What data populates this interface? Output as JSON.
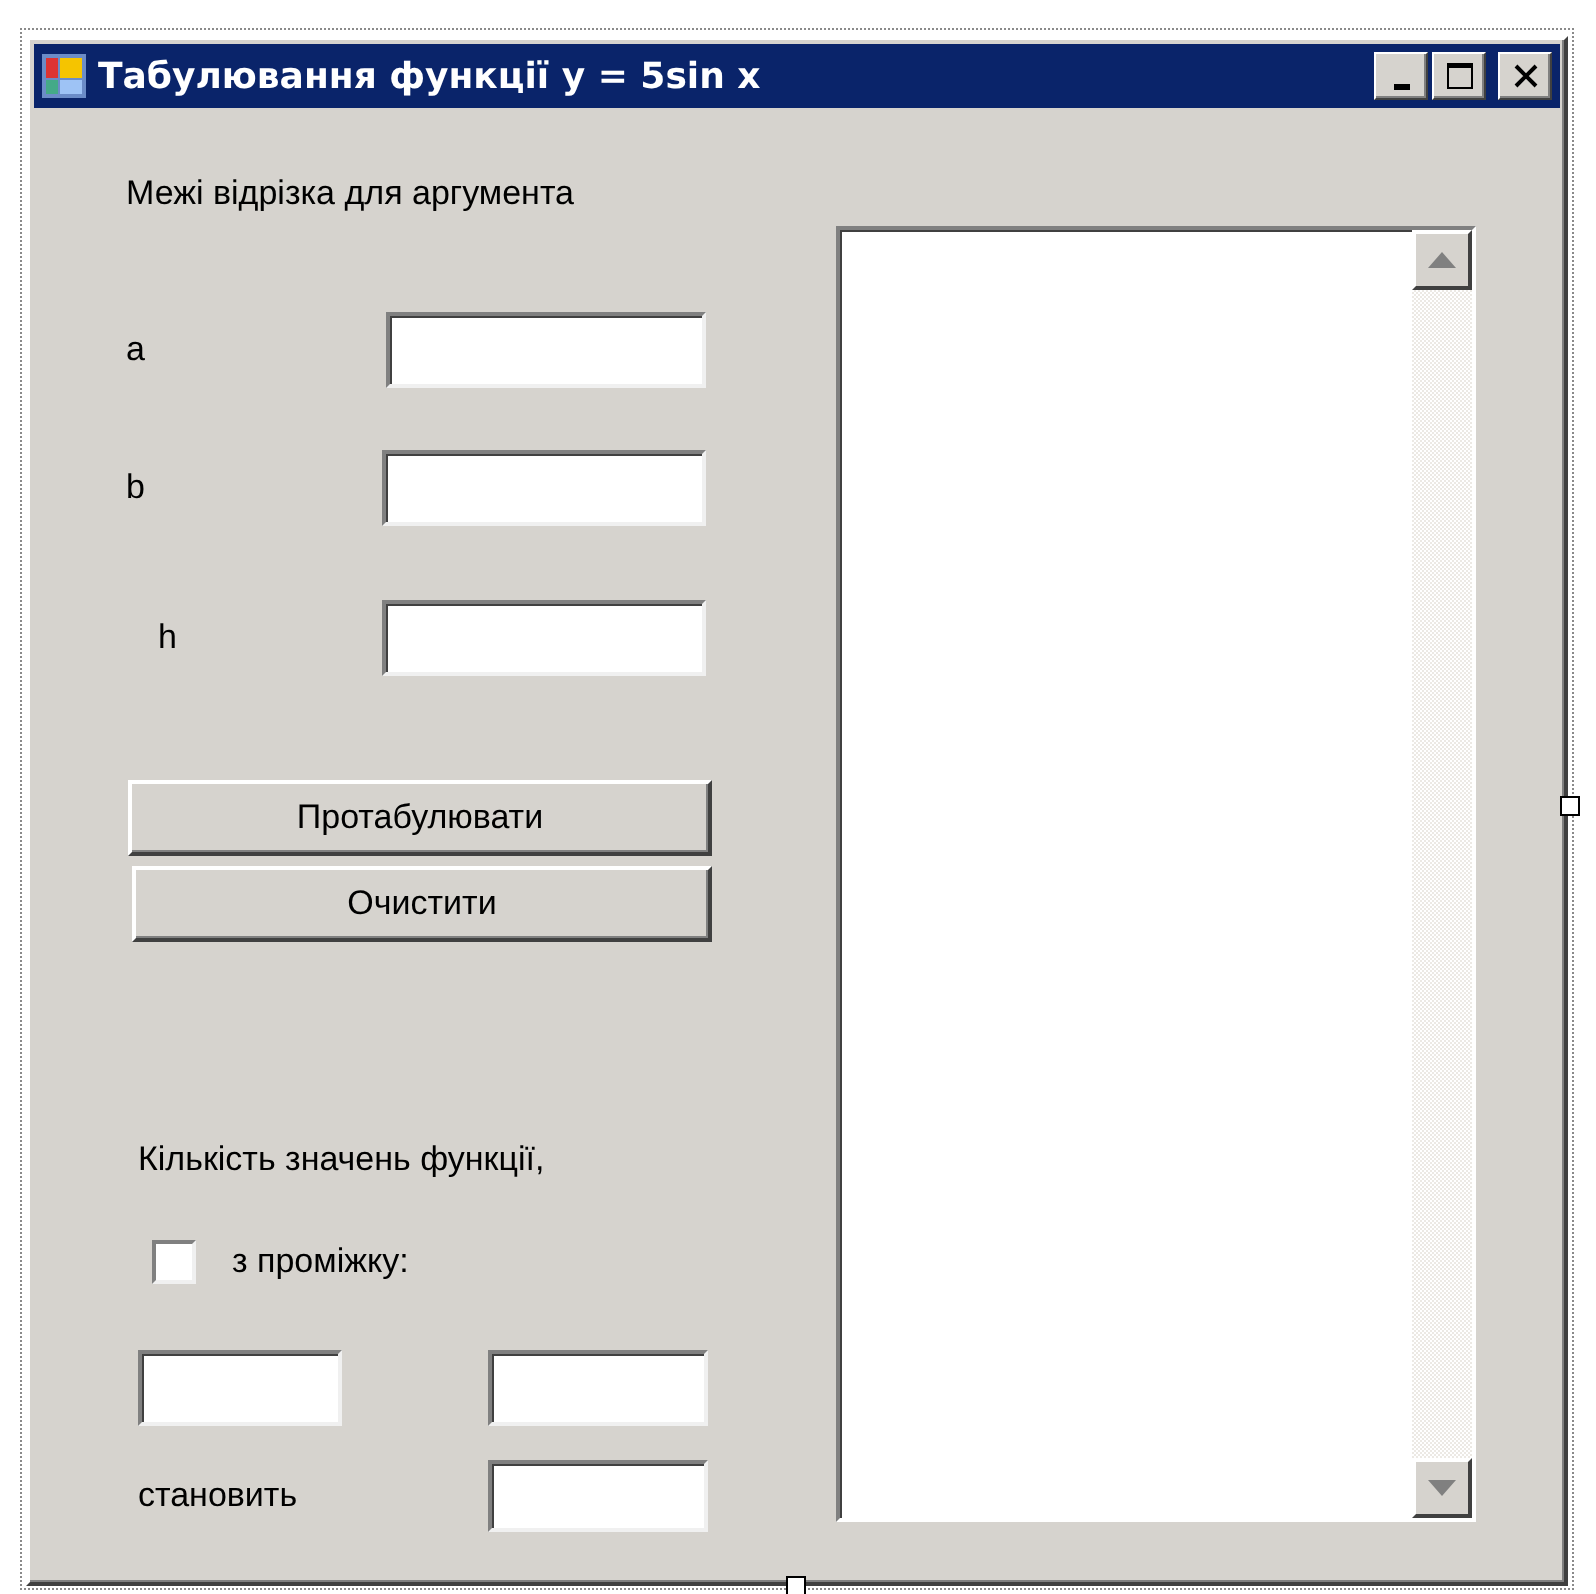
{
  "window": {
    "title": "Табулювання функції у = 5sin x"
  },
  "range_heading": "Межі відрізка для аргумента",
  "params": [
    {
      "label": "a"
    },
    {
      "label": "b"
    },
    {
      "label": "h"
    }
  ],
  "buttons": [
    {
      "label": "Протабулювати"
    },
    {
      "label": "Очистити"
    }
  ],
  "count_label": "Кількість значень функції,",
  "range_checkbox": {
    "label": "з проміжку:",
    "checked": false
  },
  "result_label": "становить"
}
